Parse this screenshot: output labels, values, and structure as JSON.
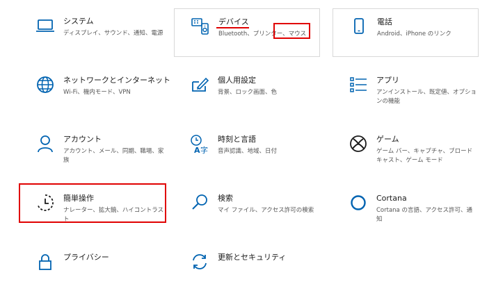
{
  "accent_color": "#0063b1",
  "annotation_color": "#e00000",
  "tiles": [
    {
      "icon": "laptop-icon",
      "title": "システム",
      "desc": "ディスプレイ、サウンド、通知、電源"
    },
    {
      "icon": "devices-icon",
      "title": "デバイス",
      "desc": "Bluetooth、プリンター、マウス"
    },
    {
      "icon": "phone-icon",
      "title": "電話",
      "desc": "Android、iPhone のリンク"
    },
    {
      "icon": "globe-icon",
      "title": "ネットワークとインターネット",
      "desc": "Wi-Fi、機内モード、VPN"
    },
    {
      "icon": "personalization-icon",
      "title": "個人用設定",
      "desc": "背景、ロック画面、色"
    },
    {
      "icon": "apps-list-icon",
      "title": "アプリ",
      "desc": "アンインストール、既定値、オプションの機能"
    },
    {
      "icon": "person-icon",
      "title": "アカウント",
      "desc": "アカウント、メール、同期、職場、家族"
    },
    {
      "icon": "time-language-icon",
      "title": "時刻と言語",
      "desc": "音声認識、地域、日付"
    },
    {
      "icon": "xbox-icon",
      "title": "ゲーム",
      "desc": "ゲーム バー、キャプチャ、ブロードキャスト、ゲーム モード"
    },
    {
      "icon": "ease-of-access-icon",
      "title": "簡単操作",
      "desc": "ナレーター、拡大鏡、ハイコントラスト"
    },
    {
      "icon": "search-icon",
      "title": "検索",
      "desc": "マイ ファイル、アクセス許可の検索"
    },
    {
      "icon": "cortana-icon",
      "title": "Cortana",
      "desc": "Cortana の言語、アクセス許可、通知"
    },
    {
      "icon": "lock-icon",
      "title": "プライバシー",
      "desc": ""
    },
    {
      "icon": "update-sync-icon",
      "title": "更新とセキュリティ",
      "desc": ""
    }
  ]
}
